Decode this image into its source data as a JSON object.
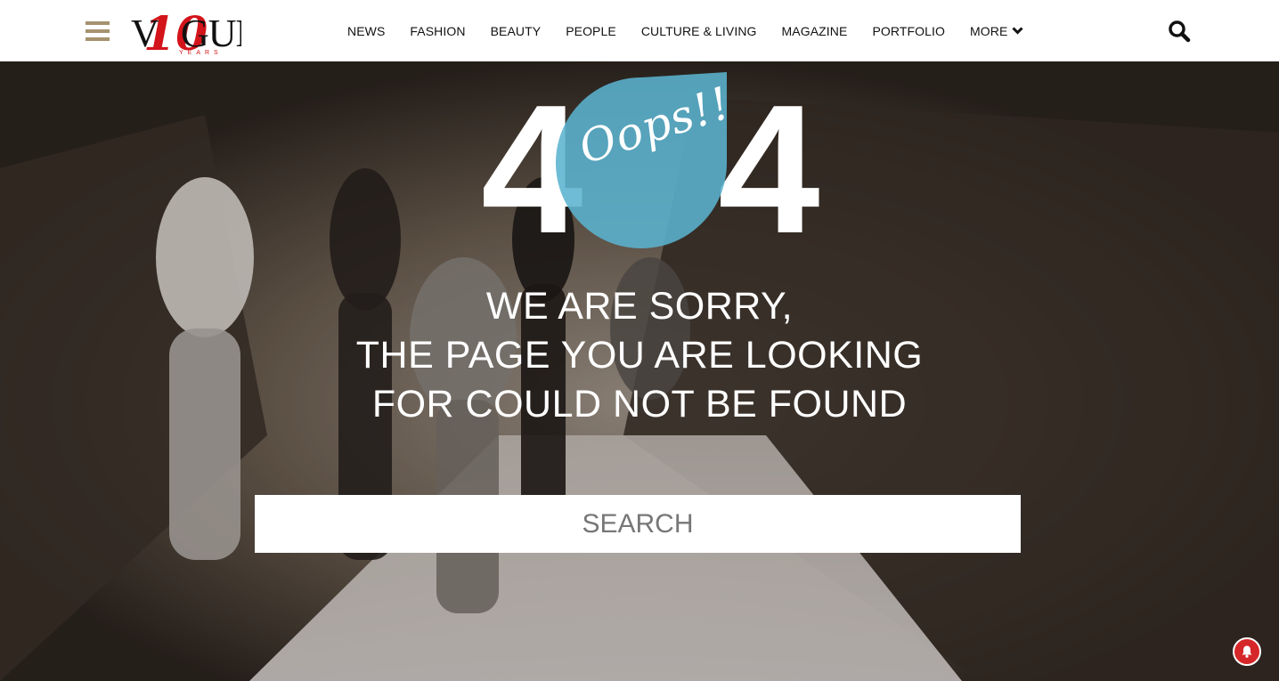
{
  "brand": {
    "logo_text": "VOGUE",
    "logo_number": "10",
    "logo_subtitle": "YEARS",
    "accent_color": "#a5926e",
    "logo_red": "#d3141a"
  },
  "nav": {
    "items": [
      {
        "label": "NEWS"
      },
      {
        "label": "FASHION"
      },
      {
        "label": "BEAUTY"
      },
      {
        "label": "PEOPLE"
      },
      {
        "label": "CULTURE & LIVING"
      },
      {
        "label": "MAGAZINE"
      },
      {
        "label": "PORTFOLIO"
      }
    ],
    "more_label": "MORE"
  },
  "icons": {
    "menu": "hamburger-icon",
    "search": "search-icon",
    "more": "chevron-down-icon",
    "notify": "bell-icon"
  },
  "error": {
    "digit_left": "4",
    "digit_right": "4",
    "oops": "Oops!!",
    "drop_color": "#5ab3cf",
    "lines": [
      "WE ARE SORRY,",
      "THE PAGE YOU ARE LOOKING",
      "FOR COULD NOT BE FOUND"
    ]
  },
  "search": {
    "placeholder": "SEARCH"
  },
  "notification": {
    "color": "#d5272a"
  }
}
